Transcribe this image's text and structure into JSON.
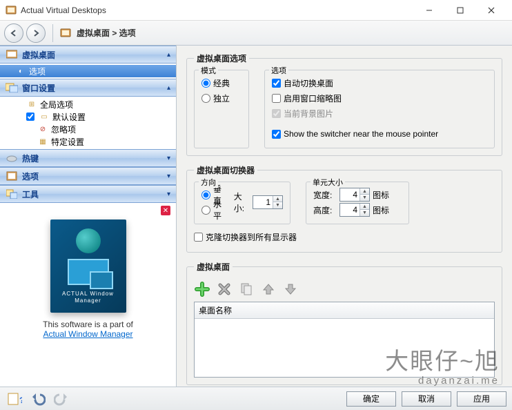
{
  "window": {
    "title": "Actual Virtual Desktops"
  },
  "breadcrumb": {
    "text": "虚拟桌面 > 选项"
  },
  "sidebar": {
    "sections": [
      {
        "label": "虚拟桌面",
        "items": [
          {
            "label": "选项",
            "selected": true
          }
        ]
      },
      {
        "label": "窗口设置",
        "items": [
          {
            "label": "全局选项"
          },
          {
            "label": "默认设置",
            "checked": true
          },
          {
            "label": "忽略项"
          },
          {
            "label": "特定设置"
          }
        ]
      },
      {
        "label": "热键"
      },
      {
        "label": "选项"
      },
      {
        "label": "工具"
      }
    ],
    "promo": {
      "product_name": "ACTUAL Window Manager",
      "line": "This software is a part of",
      "link": "Actual Window Manager"
    }
  },
  "content": {
    "options": {
      "legend": "虚拟桌面选项",
      "mode": {
        "label": "模式",
        "classic": "经典",
        "independent": "独立",
        "value": "classic"
      },
      "opts": {
        "label": "选项",
        "auto_switch": {
          "label": "自动切换桌面",
          "checked": true
        },
        "thumbs": {
          "label": "启用窗口缩略图",
          "checked": false
        },
        "bg": {
          "label": "当前背景图片",
          "checked": true,
          "disabled": true
        },
        "near_pointer": {
          "label": "Show the switcher near the mouse pointer",
          "checked": true
        }
      }
    },
    "switcher": {
      "legend": "虚拟桌面切换器",
      "direction": {
        "label": "方向",
        "vertical": "垂直",
        "horizontal": "水平",
        "value": "vertical",
        "size_label": "大小:",
        "size": "1"
      },
      "cell": {
        "label": "单元大小",
        "width_label": "宽度:",
        "width": "4",
        "height_label": "高度:",
        "height": "4",
        "unit": "图标"
      },
      "clone": {
        "label": "克隆切换器到所有显示器",
        "checked": false
      }
    },
    "vd": {
      "legend": "虚拟桌面",
      "list_header": "桌面名称"
    }
  },
  "buttons": {
    "ok": "确定",
    "cancel": "取消",
    "apply": "应用"
  },
  "watermark": {
    "big": "大眼仔~旭",
    "small": "dayanzai.me"
  }
}
